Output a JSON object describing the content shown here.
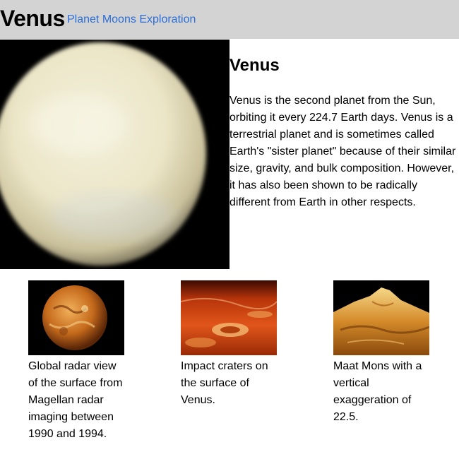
{
  "header": {
    "site_title": "Venus",
    "nav": [
      {
        "label": "Planet"
      },
      {
        "label": "Moons"
      },
      {
        "label": "Exploration"
      }
    ],
    "background_color": "#d3d3d3",
    "link_color": "#2a6ed8"
  },
  "hero": {
    "image_icon": "venus-globe-photo"
  },
  "article": {
    "title": "Venus",
    "body": "Venus is the second planet from the Sun, orbiting it every 224.7 Earth days. Venus is a terrestrial planet and is sometimes called Earth's \"sister planet\" because of their similar size, gravity, and bulk composition. However, it has also been shown to be radically different from Earth in other respects."
  },
  "gallery": [
    {
      "image_icon": "radar-globe-photo",
      "caption": "Global radar view of the surface from Magellan radar imaging between 1990 and 1994."
    },
    {
      "image_icon": "impact-craters-photo",
      "caption": "Impact craters on the surface of Venus."
    },
    {
      "image_icon": "maat-mons-photo",
      "caption": "Maat Mons with a vertical exaggeration of 22.5."
    }
  ]
}
